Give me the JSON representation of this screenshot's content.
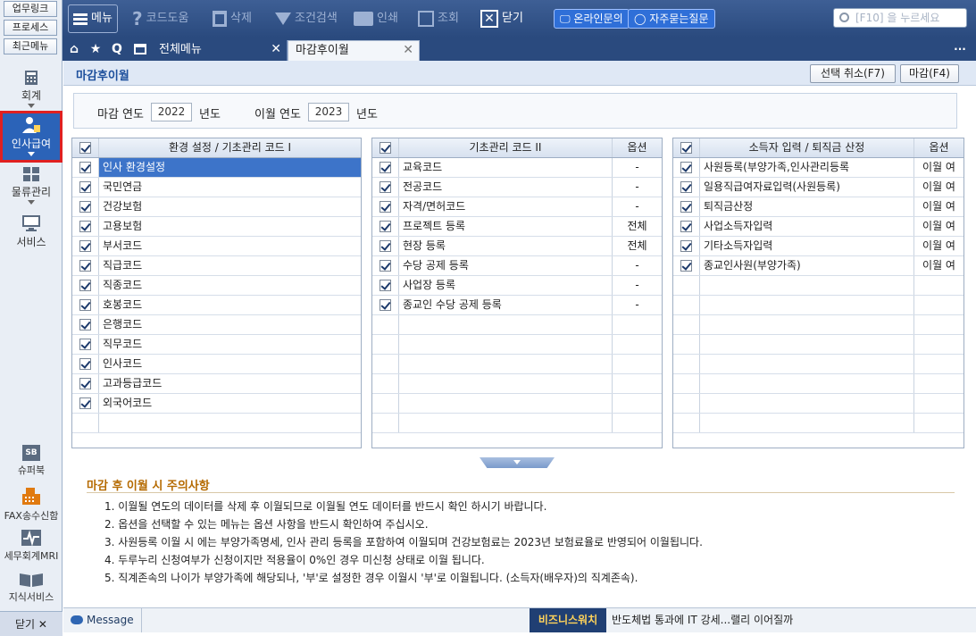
{
  "rail": {
    "links": [
      "업무링크",
      "프로세스",
      "최근메뉴"
    ],
    "modules": [
      "회계",
      "인사급여",
      "물류관리",
      "서비스"
    ],
    "bottom": [
      "슈퍼북",
      "FAX송수신함",
      "세무회계MRI",
      "지식서비스"
    ],
    "superbook_badge": "SB",
    "close": "닫기 ✕"
  },
  "toolbar": {
    "menu": "메뉴",
    "code_help": "코드도움",
    "delete": "삭제",
    "condition_search": "조건검색",
    "print": "인쇄",
    "view": "조회",
    "close": "닫기",
    "online_inquiry": "온라인문의",
    "faq": "자주묻는질문",
    "search_placeholder": "[F10] 을 누르세요"
  },
  "tabs": {
    "home_icon": "⌂",
    "star_icon": "★",
    "q_icon": "Q",
    "items": [
      "전체메뉴",
      "마감후이월"
    ],
    "more": "···"
  },
  "page": {
    "title": "마감후이월",
    "btn_cancel": "선택 취소(F7)",
    "btn_close": "마감(F4)"
  },
  "filter": {
    "close_year_label": "마감 연도",
    "close_year": "2022",
    "year_suffix1": "년도",
    "carry_year_label": "이월 연도",
    "carry_year": "2023",
    "year_suffix2": "년도"
  },
  "grid1": {
    "header": "환경 설정 / 기초관리 코드 I",
    "rows": [
      "인사 환경설정",
      "국민연금",
      "건강보험",
      "고용보험",
      "부서코드",
      "직급코드",
      "직종코드",
      "호봉코드",
      "은행코드",
      "직무코드",
      "인사코드",
      "고과등급코드",
      "외국어코드"
    ]
  },
  "grid2": {
    "header": "기초관리 코드 II",
    "opt_header": "옵션",
    "rows": [
      {
        "name": "교육코드",
        "opt": "-"
      },
      {
        "name": "전공코드",
        "opt": "-"
      },
      {
        "name": "자격/면허코드",
        "opt": "-"
      },
      {
        "name": "프로젝트 등록",
        "opt": "전체"
      },
      {
        "name": "현장 등록",
        "opt": "전체"
      },
      {
        "name": "수당 공제 등록",
        "opt": "-"
      },
      {
        "name": "사업장 등록",
        "opt": "-"
      },
      {
        "name": "종교인 수당 공제 등록",
        "opt": "-"
      }
    ]
  },
  "grid3": {
    "header": "소득자 입력 / 퇴직금 산정",
    "opt_header": "옵션",
    "rows": [
      {
        "name": "사원등록(부양가족,인사관리등록",
        "opt": "이월 여"
      },
      {
        "name": "일용직급여자료입력(사원등록)",
        "opt": "이월 여"
      },
      {
        "name": "퇴직금산정",
        "opt": "이월 여"
      },
      {
        "name": "사업소득자입력",
        "opt": "이월 여"
      },
      {
        "name": "기타소득자입력",
        "opt": "이월 여"
      },
      {
        "name": "종교인사원(부양가족)",
        "opt": "이월 여"
      }
    ]
  },
  "notes": {
    "title": "마감 후 이월 시 주의사항",
    "lines": [
      "1. 이월될 연도의 데이터를 삭제 후 이월되므로 이월될 연도 데이터를 반드시 확인 하시기 바랍니다.",
      "2. 옵션을 선택할 수 있는 메뉴는 옵션 사항을 반드시 확인하여 주십시오.",
      "3. 사원등록 이월 시 에는 부양가족명세, 인사 관리 등록을 포함하여 이월되며 건강보험료는 2023년 보험료율로 반영되어 이월됩니다.",
      "4. 두루누리 신청여부가 신청이지만 적용율이 0%인 경우 미신청 상태로 이월 됩니다.",
      "5. 직계존속의 나이가 부양가족에 해당되나, '부'로 설정한 경우 이월시 '부'로 이월됩니다. (소득자(배우자)의 직계존속)."
    ]
  },
  "status": {
    "message": "Message",
    "biz": "비즈니스워치",
    "ticker": "반도체법 통과에 IT 강세...랠리 이어질까"
  }
}
